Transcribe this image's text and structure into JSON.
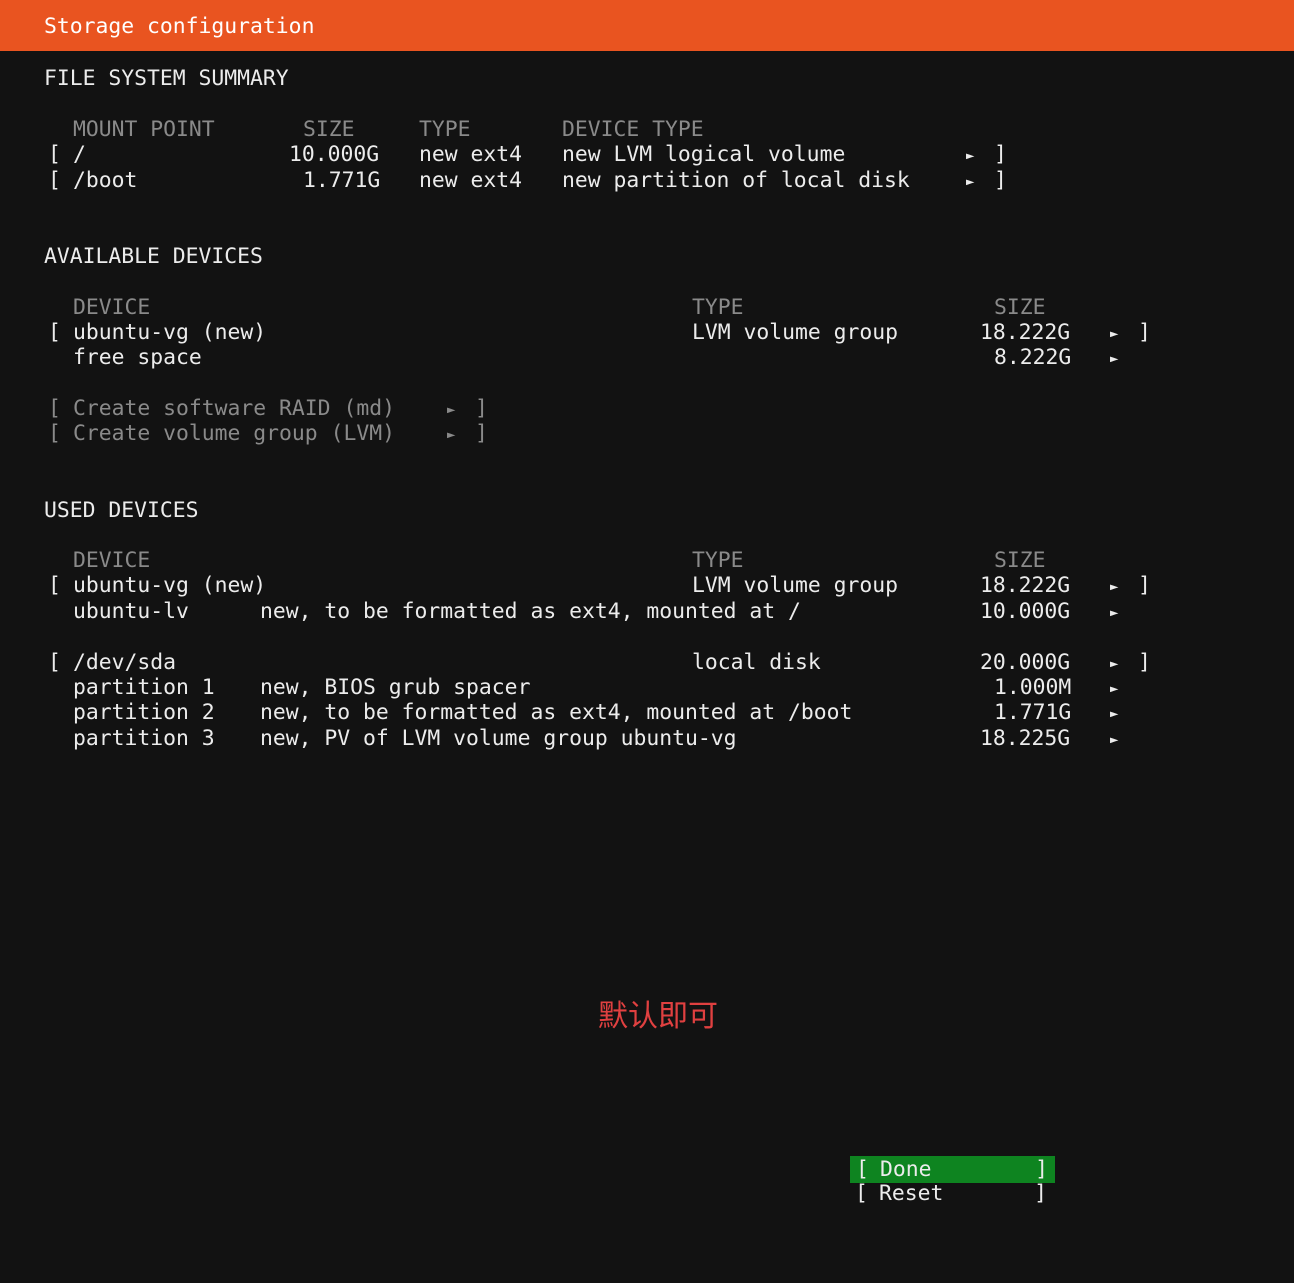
{
  "header": {
    "title": "Storage configuration"
  },
  "fs_summary": {
    "title": "FILE SYSTEM SUMMARY",
    "columns": [
      "MOUNT POINT",
      "SIZE",
      "TYPE",
      "DEVICE TYPE"
    ],
    "rows": [
      {
        "mount": "/",
        "size": "10.000G",
        "type": "new ext4",
        "device_type": "new LVM logical volume"
      },
      {
        "mount": "/boot",
        "size": "1.771G",
        "type": "new ext4",
        "device_type": "new partition of local disk"
      }
    ]
  },
  "available": {
    "title": "AVAILABLE DEVICES",
    "columns": [
      "DEVICE",
      "TYPE",
      "SIZE"
    ],
    "rows": [
      {
        "device": "ubuntu-vg (new)",
        "type": "LVM volume group",
        "size": "18.222G"
      },
      {
        "device": "free space",
        "type": "",
        "size": "8.222G"
      }
    ],
    "actions": [
      "Create software RAID (md)",
      "Create volume group (LVM)"
    ]
  },
  "used": {
    "title": "USED DEVICES",
    "columns": [
      "DEVICE",
      "TYPE",
      "SIZE"
    ],
    "group1": [
      {
        "device": "ubuntu-vg (new)",
        "desc": "",
        "type": "LVM volume group",
        "size": "18.222G"
      },
      {
        "device": "ubuntu-lv",
        "desc": "new, to be formatted as ext4, mounted at /",
        "type": "",
        "size": "10.000G"
      }
    ],
    "group2": [
      {
        "device": "/dev/sda",
        "desc": "",
        "type": "local disk",
        "size": "20.000G"
      },
      {
        "device": "partition 1",
        "desc": "new, BIOS grub spacer",
        "type": "",
        "size": "1.000M"
      },
      {
        "device": "partition 2",
        "desc": "new, to be formatted as ext4, mounted at /boot",
        "type": "",
        "size": "1.771G"
      },
      {
        "device": "partition 3",
        "desc": "new, PV of LVM volume group ubuntu-vg",
        "type": "",
        "size": "18.225G"
      }
    ]
  },
  "annotation": "默认即可",
  "buttons": {
    "done": "Done",
    "reset": "Reset"
  },
  "glyphs": {
    "arrow": "►",
    "open": "[",
    "close": "]"
  }
}
